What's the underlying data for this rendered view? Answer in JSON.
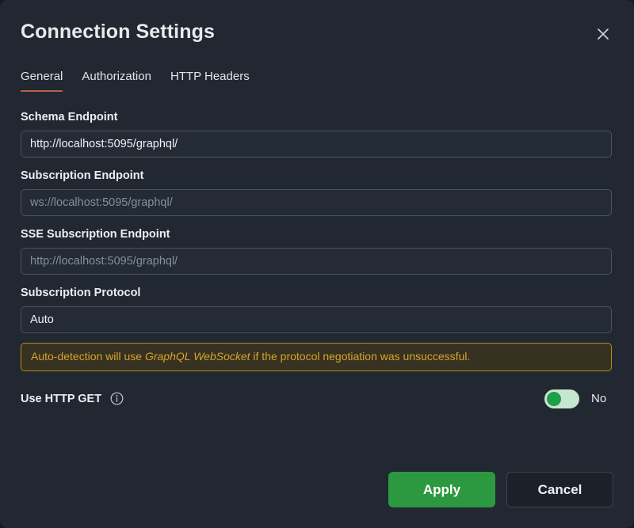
{
  "dialog": {
    "title": "Connection Settings",
    "close_icon": "close-icon"
  },
  "tabs": [
    {
      "label": "General",
      "active": true
    },
    {
      "label": "Authorization",
      "active": false
    },
    {
      "label": "HTTP Headers",
      "active": false
    }
  ],
  "fields": {
    "schema_endpoint": {
      "label": "Schema Endpoint",
      "value": "http://localhost:5095/graphql/",
      "placeholder": ""
    },
    "subscription_endpoint": {
      "label": "Subscription Endpoint",
      "value": "",
      "placeholder": "ws://localhost:5095/graphql/"
    },
    "sse_subscription_endpoint": {
      "label": "SSE Subscription Endpoint",
      "value": "",
      "placeholder": "http://localhost:5095/graphql/"
    },
    "subscription_protocol": {
      "label": "Subscription Protocol",
      "value": "Auto",
      "placeholder": ""
    }
  },
  "warning": {
    "text_before": "Auto-detection will use ",
    "emphasis": "GraphQL WebSocket",
    "text_after": " if the protocol negotiation was unsuccessful."
  },
  "http_get": {
    "label": "Use HTTP GET",
    "info_icon": "info-icon",
    "toggle_value": "No"
  },
  "footer": {
    "apply_label": "Apply",
    "cancel_label": "Cancel"
  },
  "colors": {
    "dialog_bg": "#222831",
    "accent_tab": "#b5614a",
    "warning_border": "#b38b17",
    "warning_text": "#d6a52a",
    "toggle_track": "#c7e6cf",
    "toggle_knob": "#1f9e4c",
    "apply_bg": "#2c9840"
  }
}
